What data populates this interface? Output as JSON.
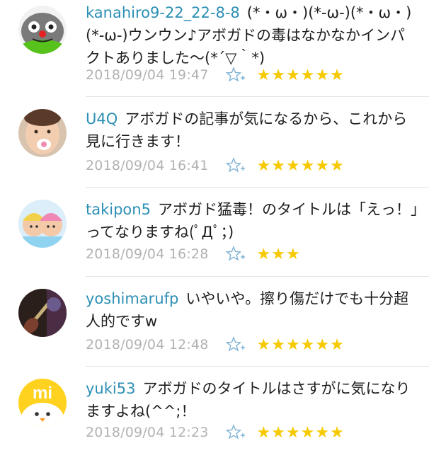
{
  "comments": [
    {
      "username": "kanahiro9-22_22-8-8",
      "text": "(*・ω・)(*-ω-)(*・ω・)(*-ω-)ウンウン♪アボガドの毒はなかなかインパクトありました〜(*´▽｀*)",
      "timestamp": "2018/09/04 19:47",
      "stars": "★★★★★★",
      "avatar_icon": "cartoon-face-avatar-icon"
    },
    {
      "username": "U4Q",
      "text": "アボガドの記事が気になるから、これから見に行きます！",
      "timestamp": "2018/09/04 16:41",
      "stars": "★★★★★★",
      "avatar_icon": "baby-photo-avatar-icon"
    },
    {
      "username": "takipon5",
      "text": "アボガド猛毒！のタイトルは「えっ！」ってなりますね(ﾟДﾟ；)",
      "timestamp": "2018/09/04 16:28",
      "stars": "★★★",
      "avatar_icon": "kids-drawing-avatar-icon"
    },
    {
      "username": "yoshimarufp",
      "text": "いやいや。擦り傷だけでも十分超人的ですw",
      "timestamp": "2018/09/04 12:48",
      "stars": "★★★★★★",
      "avatar_icon": "guitar-photo-avatar-icon"
    },
    {
      "username": "yuki53",
      "text": "アボガドのタイトルはさすがに気になりますよね(^^;！",
      "timestamp": "2018/09/04 12:23",
      "stars": "★★★★★★",
      "avatar_icon": "mi-chick-avatar-icon"
    }
  ],
  "add_star_icon": "add-star-icon",
  "colors": {
    "username": "#2c8fb4",
    "timestamp": "#b2b2b2",
    "star": "#f6c900",
    "add_star": "#7fb3d5",
    "divider": "#e3e3e3"
  },
  "avatar_logo_text": "mi"
}
